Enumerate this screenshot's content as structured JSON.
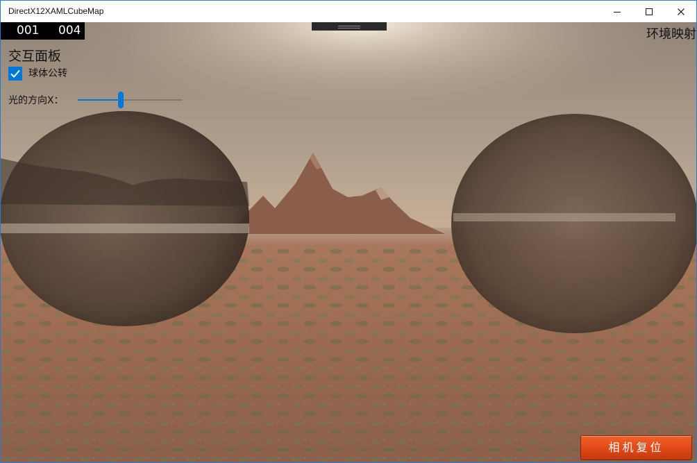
{
  "window": {
    "title": "DirectX12XAMLCubeMap",
    "controls": {
      "minimize_icon": "minimize-icon",
      "maximize_icon": "maximize-icon",
      "close_icon": "close-icon"
    }
  },
  "stats": {
    "counter_a": "001",
    "counter_b": "004"
  },
  "panel": {
    "title": "交互面板",
    "checkbox_label": "球体公转",
    "checkbox_checked": true,
    "slider_label": "光的方向X：",
    "slider_value": 0.41
  },
  "corner_label": "环境映射",
  "reset_button": {
    "label": "相机复位"
  },
  "colors": {
    "accent": "#0078d7",
    "button": "#e34a18",
    "window_border": "#2b79d0"
  }
}
